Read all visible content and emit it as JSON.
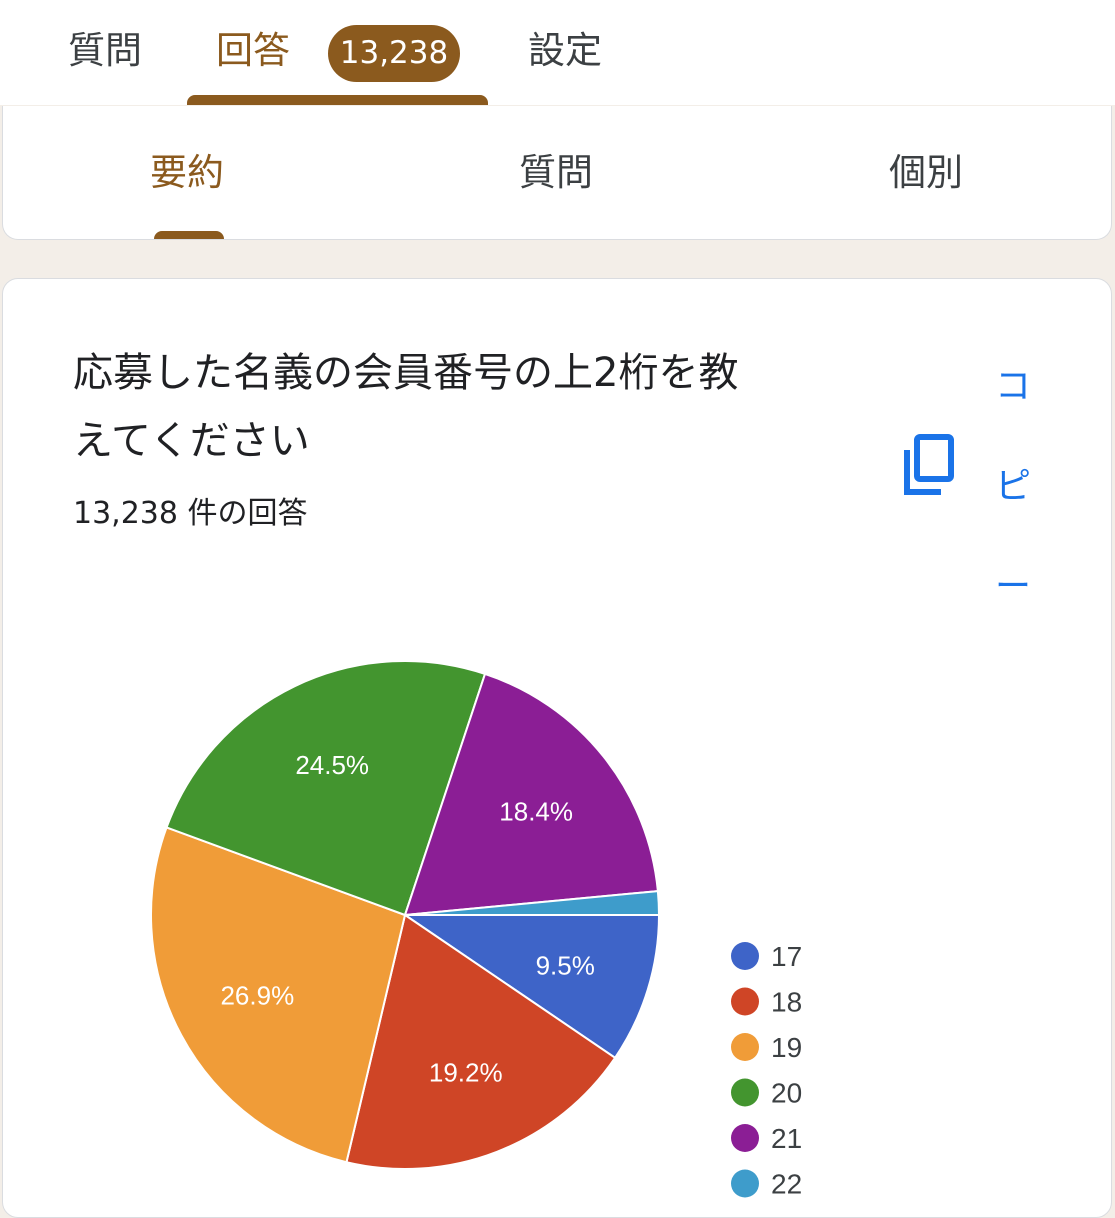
{
  "tabs": {
    "questions": "質問",
    "responses": "回答",
    "response_count_badge": "13,238",
    "settings": "設定"
  },
  "subtabs": {
    "summary": "要約",
    "question": "質問",
    "individual": "個別"
  },
  "card": {
    "title_line1": "応募した名義の会員番号の上2桁を教",
    "title_line2": "えてください",
    "response_count": "13,238 件の回答",
    "copy_label": [
      "コ",
      "ピ",
      "ー"
    ]
  },
  "colors": {
    "accent": "#8b5a1e",
    "link": "#1a73e8"
  },
  "chart_data": {
    "type": "pie",
    "categories": [
      "17",
      "18",
      "19",
      "20",
      "21",
      "22"
    ],
    "values": [
      9.5,
      19.2,
      26.9,
      24.5,
      18.4,
      1.5
    ],
    "labels": [
      "9.5%",
      "19.2%",
      "26.9%",
      "24.5%",
      "18.4%",
      ""
    ],
    "colors": [
      "#3e64c8",
      "#cf4526",
      "#f09c38",
      "#43952f",
      "#8b1e95",
      "#3e9ccb"
    ],
    "legend_position": "right"
  }
}
